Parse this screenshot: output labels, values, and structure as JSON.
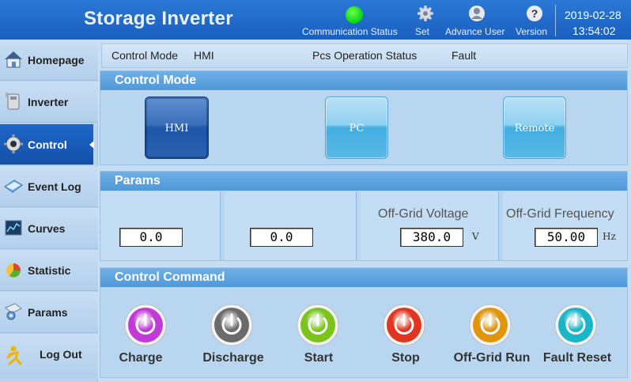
{
  "header": {
    "title": "Storage Inverter",
    "comm_status_label": "Communication Status",
    "set_label": "Set",
    "advance_user_label": "Advance User",
    "version_label": "Version",
    "date": "2019-02-28",
    "time": "13:54:02",
    "comm_status_color": "#11d91a"
  },
  "sidebar": {
    "items": [
      {
        "label": "Homepage",
        "icon": "home-icon"
      },
      {
        "label": "Inverter",
        "icon": "inverter-icon"
      },
      {
        "label": "Control",
        "icon": "gear-icon",
        "active": true
      },
      {
        "label": "Event Log",
        "icon": "event-log-icon"
      },
      {
        "label": "Curves",
        "icon": "curves-icon"
      },
      {
        "label": "Statistic",
        "icon": "pie-chart-icon"
      },
      {
        "label": "Params",
        "icon": "params-icon"
      },
      {
        "label": "Log Out",
        "icon": "logout-icon"
      }
    ]
  },
  "status": {
    "control_mode_label": "Control Mode",
    "control_mode_value": "HMI",
    "pcs_status_label": "Pcs Operation Status",
    "pcs_status_value": "Fault"
  },
  "control_mode": {
    "title": "Control Mode",
    "options": [
      "HMI",
      "PC",
      "Remote"
    ],
    "selected": "HMI"
  },
  "params": {
    "title": "Params",
    "fields": [
      {
        "label": "",
        "value": "0.0",
        "unit": ""
      },
      {
        "label": "",
        "value": "0.0",
        "unit": ""
      },
      {
        "label": "Off-Grid Voltage",
        "value": "380.0",
        "unit": "V"
      },
      {
        "label": "Off-Grid Frequency",
        "value": "50.00",
        "unit": "Hz"
      }
    ]
  },
  "commands": {
    "title": "Control Command",
    "buttons": [
      {
        "label": "Charge",
        "color": "#c23ad6"
      },
      {
        "label": "Discharge",
        "color": "#6b6b6b"
      },
      {
        "label": "Start",
        "color": "#7ac41c"
      },
      {
        "label": "Stop",
        "color": "#e2341f"
      },
      {
        "label": "Off-Grid Run",
        "color": "#e0950d"
      },
      {
        "label": "Fault Reset",
        "color": "#18b6c6"
      }
    ]
  }
}
